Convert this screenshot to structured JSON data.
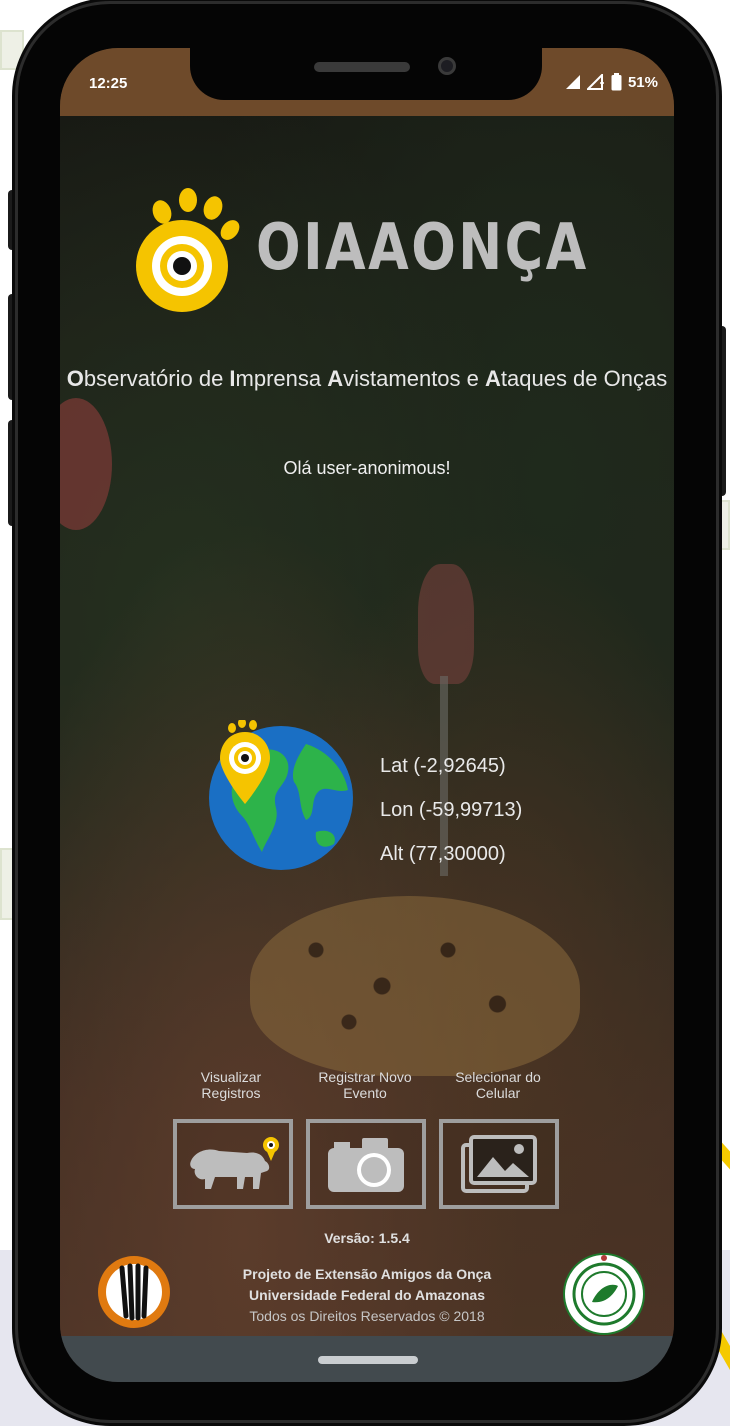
{
  "status_bar": {
    "time": "12:25",
    "battery": "51%",
    "icons": [
      "signal-icon",
      "signal-alt-icon",
      "battery-icon"
    ]
  },
  "app": {
    "logo_text": "OIAAONÇA",
    "subtitle_parts": [
      {
        "text": "O",
        "bold": true
      },
      {
        "text": "bservatório de ",
        "bold": false
      },
      {
        "text": "I",
        "bold": true
      },
      {
        "text": "mprensa ",
        "bold": false
      },
      {
        "text": "A",
        "bold": true
      },
      {
        "text": "vistamentos e ",
        "bold": false
      },
      {
        "text": "A",
        "bold": true
      },
      {
        "text": "taques de Onças",
        "bold": false
      }
    ],
    "greeting": "Olá user-anonimous!",
    "location": {
      "lat": "Lat (-2,92645)",
      "lon": "Lon (-59,99713)",
      "alt": "Alt (77,30000)"
    },
    "actions": [
      {
        "label": "Visualizar Registros",
        "icon": "jaguar-pin-icon"
      },
      {
        "label": "Registrar Novo Evento",
        "icon": "camera-icon"
      },
      {
        "label": "Selecionar do Celular",
        "icon": "gallery-icon"
      }
    ],
    "version": "Versão: 1.5.4",
    "credits": {
      "project": "Projeto de Extensão Amigos da Onça",
      "university": "Universidade Federal do Amazonas",
      "rights": "Todos os Direitos Reservados © 2018"
    },
    "colors": {
      "accent_yellow": "#f5c400",
      "status_bar": "#6e4a2a",
      "logo_grey": "#bdbdbd"
    }
  }
}
